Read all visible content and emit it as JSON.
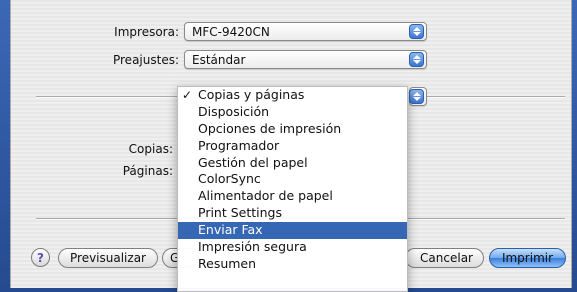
{
  "printer": {
    "label": "Impresora:",
    "value": "MFC-9420CN"
  },
  "presets": {
    "label": "Preajustes:",
    "value": "Estándar"
  },
  "copies": {
    "label": "Copias:"
  },
  "pages": {
    "label": "Páginas:"
  },
  "menu": {
    "checked_index": 0,
    "highlighted_index": 9,
    "items": [
      {
        "label": "Copias y páginas"
      },
      {
        "label": "Disposición"
      },
      {
        "label": "Opciones de impresión"
      },
      {
        "label": "Programador"
      },
      {
        "label": "Gestión del papel"
      },
      {
        "label": "ColorSync"
      },
      {
        "label": "Alimentador de papel"
      },
      {
        "label": "Print Settings"
      },
      {
        "label": "Enviar Fax"
      },
      {
        "label": "Impresión segura"
      },
      {
        "label": "Resumen"
      }
    ],
    "checkmark": "✓"
  },
  "buttons": {
    "help": "?",
    "preview": "Previsualizar",
    "pdf_partial": "G",
    "cancel": "Cancelar",
    "print": "Imprimir"
  },
  "colors": {
    "highlight": "#3567b5",
    "default_button": "#3b7fdc"
  }
}
